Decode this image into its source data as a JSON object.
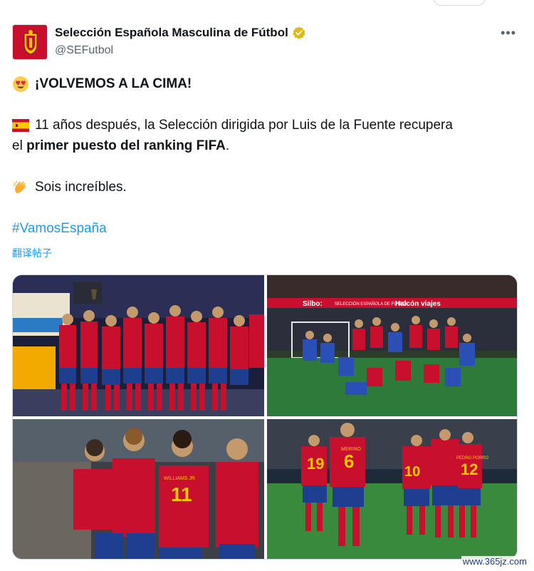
{
  "author": {
    "display_name": "Selección Española Masculina de Fútbol",
    "handle": "@SEFutbol",
    "verified": true
  },
  "tweet": {
    "title": "¡VOLVEMOS A LA CIMA!",
    "line2_pre": "11 años después, la Selección dirigida por Luis de la Fuente recupera",
    "line3_pre": "el ",
    "line3_bold": "primer puesto del ranking FIFA",
    "line3_post": ".",
    "line4": "Sois increíbles.",
    "hashtag": "#VamosEspaña",
    "translate": "翻译帖子"
  },
  "media": {
    "photo_alts": [
      "team-celebration-trophy",
      "stadium-team-photo",
      "players-celebrating",
      "players-high-five"
    ],
    "banner_texts": [
      "Silbo:",
      "SELECCIÓN ESPAÑOLA DE FÚTBOL",
      "Halcón viajes"
    ],
    "jersey_numbers": [
      "11",
      "19",
      "6",
      "10",
      "12"
    ],
    "jersey_names": [
      "WILLIAMS JR",
      "MERINO",
      "PEDRO PORRO"
    ]
  },
  "watermark": "www.365jz.com",
  "colors": {
    "accent": "#1d9bf0",
    "spain_red": "#c8102e",
    "spain_yellow": "#f6c800"
  }
}
